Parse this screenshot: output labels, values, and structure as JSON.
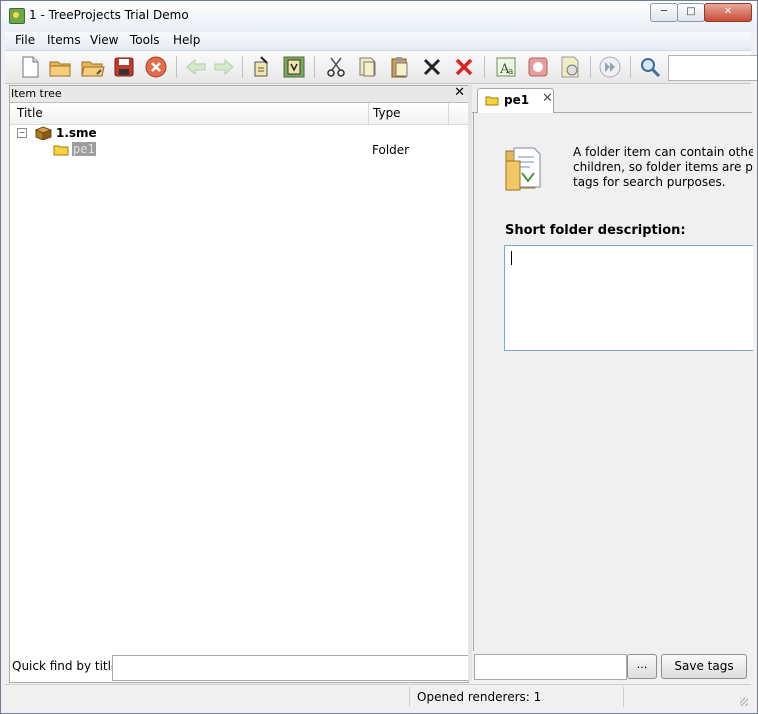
{
  "window": {
    "title": "1 - TreeProjects Trial Demo"
  },
  "menubar": {
    "items": [
      "File",
      "Items",
      "View",
      "Tools",
      "Help"
    ]
  },
  "toolbar": {
    "buttons": [
      "new-file-icon",
      "open-folder-icon",
      "open-recent-icon",
      "save-icon",
      "close-circle-icon",
      "back-arrow-icon",
      "forward-arrow-icon",
      "clipboard-pin-icon",
      "paste-special-icon",
      "cut-icon",
      "copy-icon",
      "paste-icon",
      "cross-black-icon",
      "delete-red-icon",
      "text-font-icon",
      "print-icon",
      "document-clock-icon",
      "play-forward-icon",
      "search-icon"
    ],
    "search_value": ""
  },
  "item_tree": {
    "title": "Item tree",
    "columns": {
      "title": "Title",
      "type": "Type"
    },
    "root": {
      "label": "1.sme",
      "expander": "⊟"
    },
    "children": [
      {
        "label": "pe1",
        "type": "Folder"
      }
    ]
  },
  "quick_find": {
    "label": "Quick find by title:",
    "value": ""
  },
  "editor": {
    "tab": {
      "label": "pe1"
    },
    "description_lines": [
      "A folder item can contain other it",
      "children, so folder items are provi",
      "tags for search purposes."
    ],
    "heading": "Short folder description:",
    "textarea_value": ""
  },
  "tags": {
    "value": "",
    "browse_label": "...",
    "save_label": "Save tags"
  },
  "statusbar": {
    "text": "Opened renderers: 1"
  }
}
